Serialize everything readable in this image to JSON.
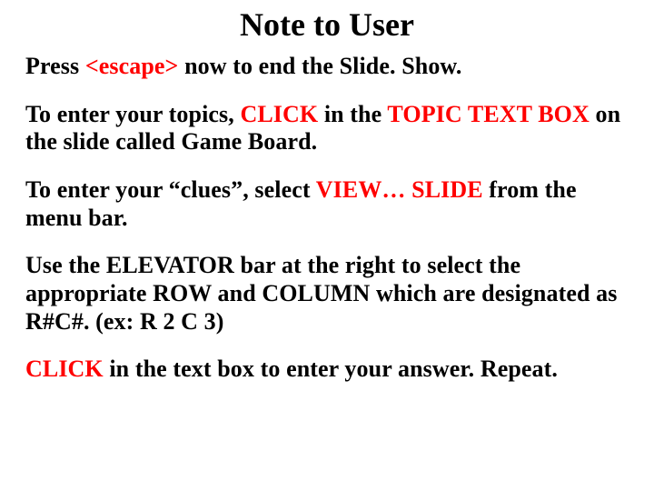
{
  "title": "Note to User",
  "p1": {
    "a": "Press ",
    "b": "<escape>",
    "c": " now to end the Slide. Show."
  },
  "p2": {
    "a": "To enter your topics, ",
    "b": "CLICK",
    "c": " in the ",
    "d": "TOPIC TEXT BOX",
    "e": " on the slide called Game Board."
  },
  "p3": {
    "a": "To enter your “clues”, select ",
    "b": "VIEW… SLIDE",
    "c": " from the menu bar."
  },
  "p4": "Use the ELEVATOR bar at the right to select the appropriate ROW and COLUMN which are designated as R#C#. (ex: R 2 C 3)",
  "p5": {
    "a": "CLICK",
    "b": " in the text box to enter your answer. Repeat."
  }
}
